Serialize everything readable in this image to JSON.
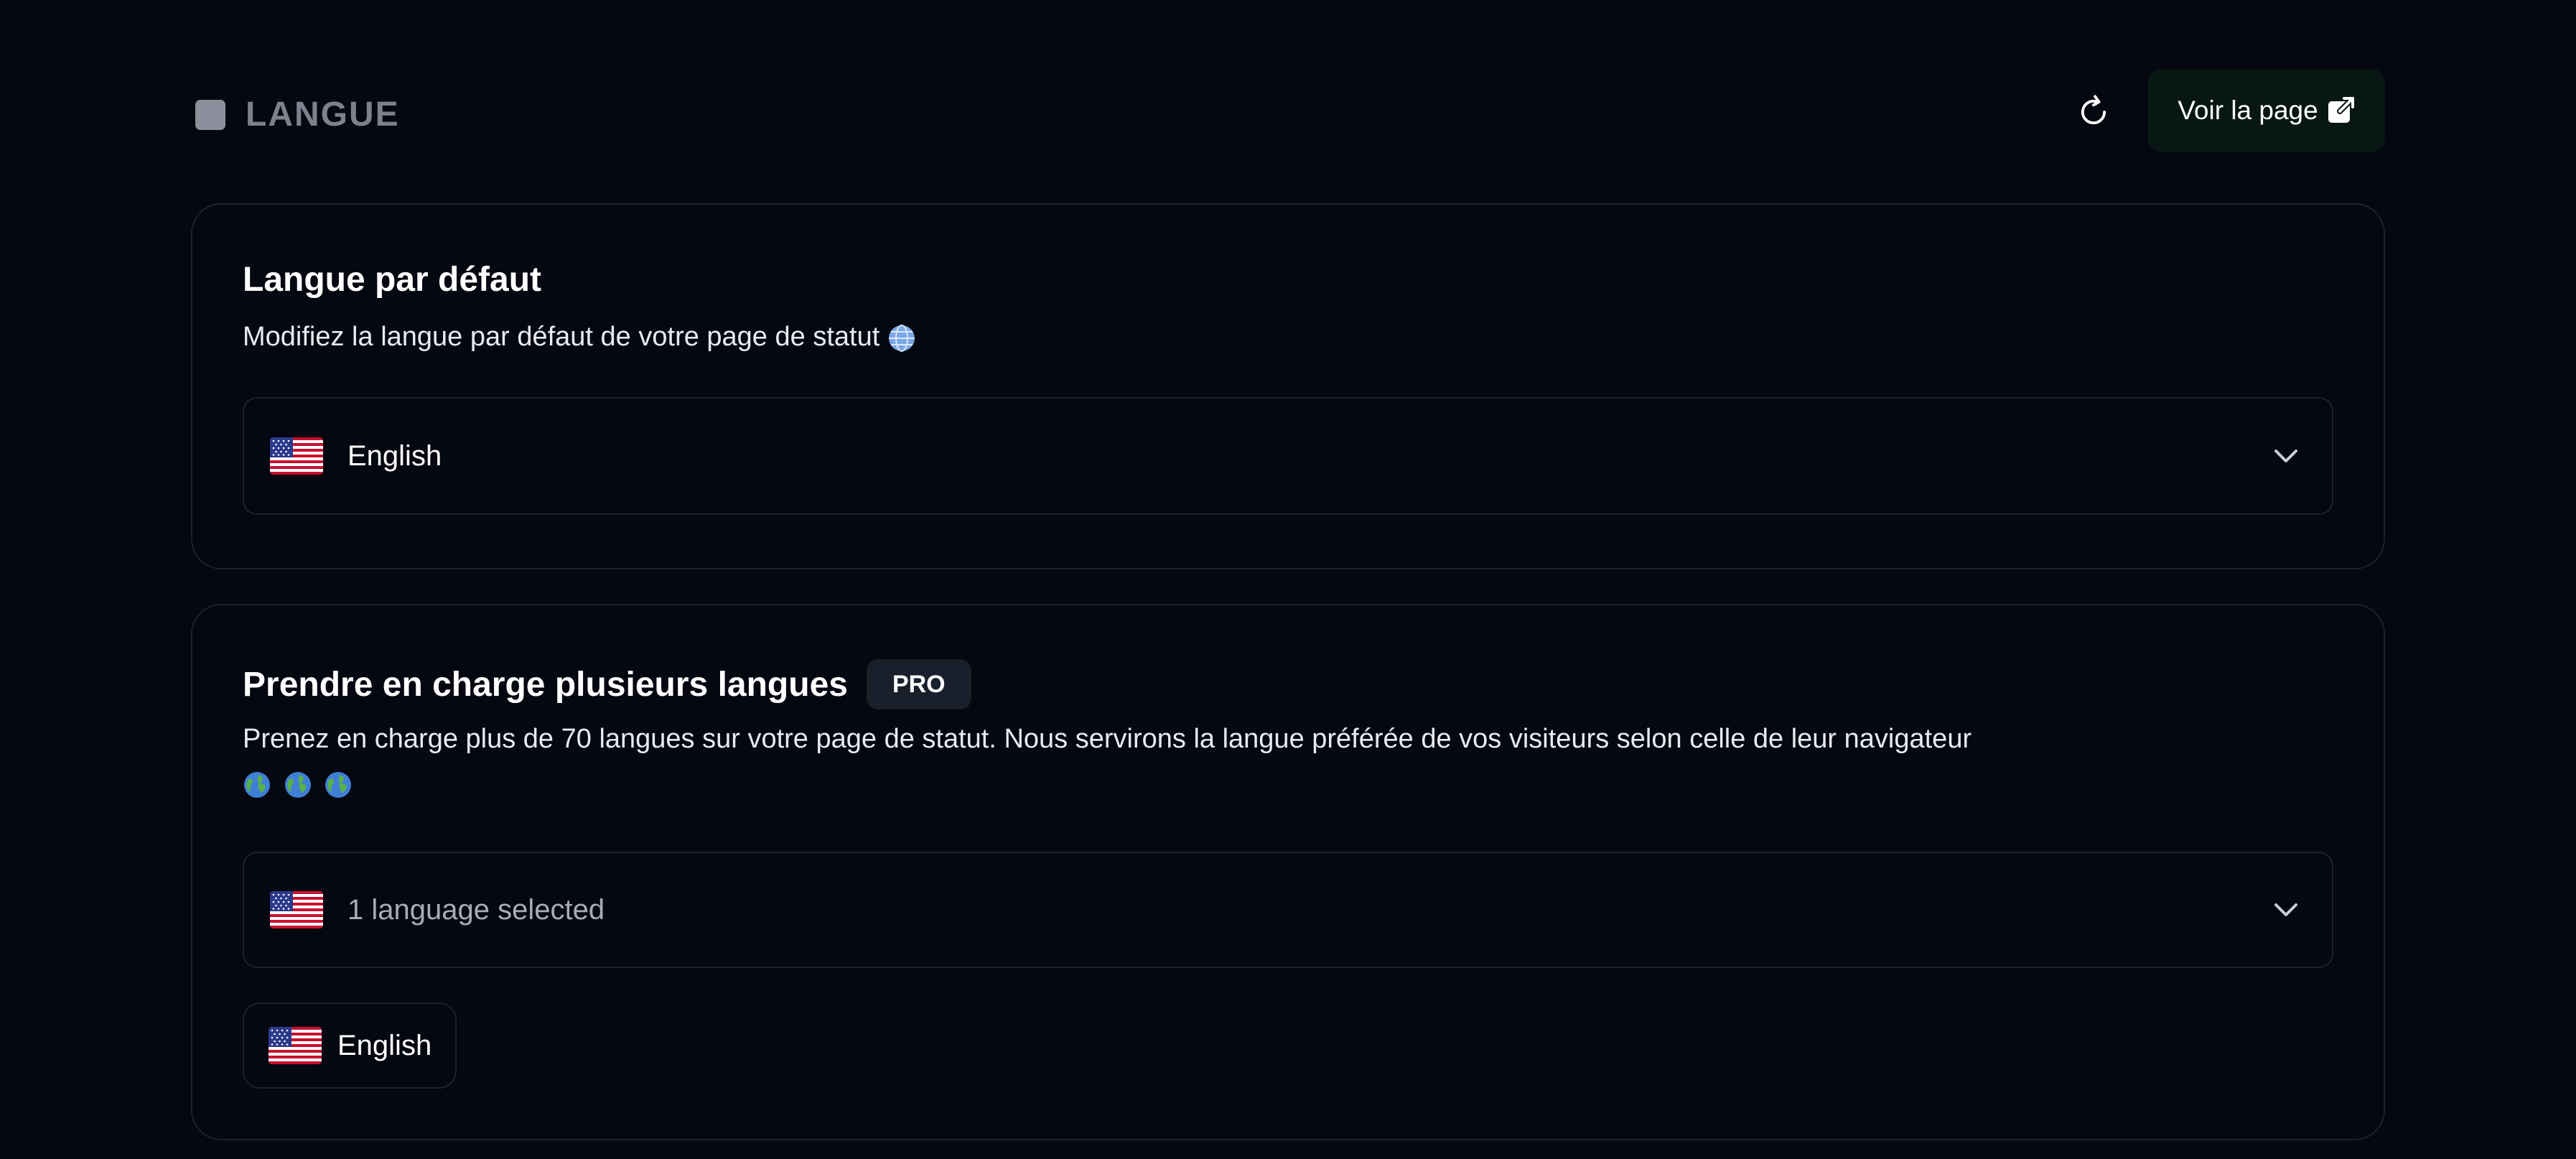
{
  "header": {
    "title": "LANGUE",
    "view_button_label": "Voir la page"
  },
  "default_language": {
    "title": "Langue par défaut",
    "description": "Modifiez la langue par défaut de votre page de statut",
    "selected": "English"
  },
  "multi_language": {
    "title": "Prendre en charge plusieurs langues",
    "badge": "PRO",
    "description": "Prenez en charge plus de 70 langues sur votre page de statut. Nous servirons la langue préférée de vos visiteurs selon celle de leur navigateur",
    "select_summary": "1 language selected",
    "chips": [
      "English"
    ]
  },
  "colors": {
    "background": "#050711",
    "border": "#1d2130",
    "view_button_bg": "#081714",
    "badge_bg": "#1a1f2c"
  },
  "icons": [
    "refresh-icon",
    "external-link-icon",
    "globe-icon",
    "us-flag-icon",
    "chevron-down-icon"
  ]
}
